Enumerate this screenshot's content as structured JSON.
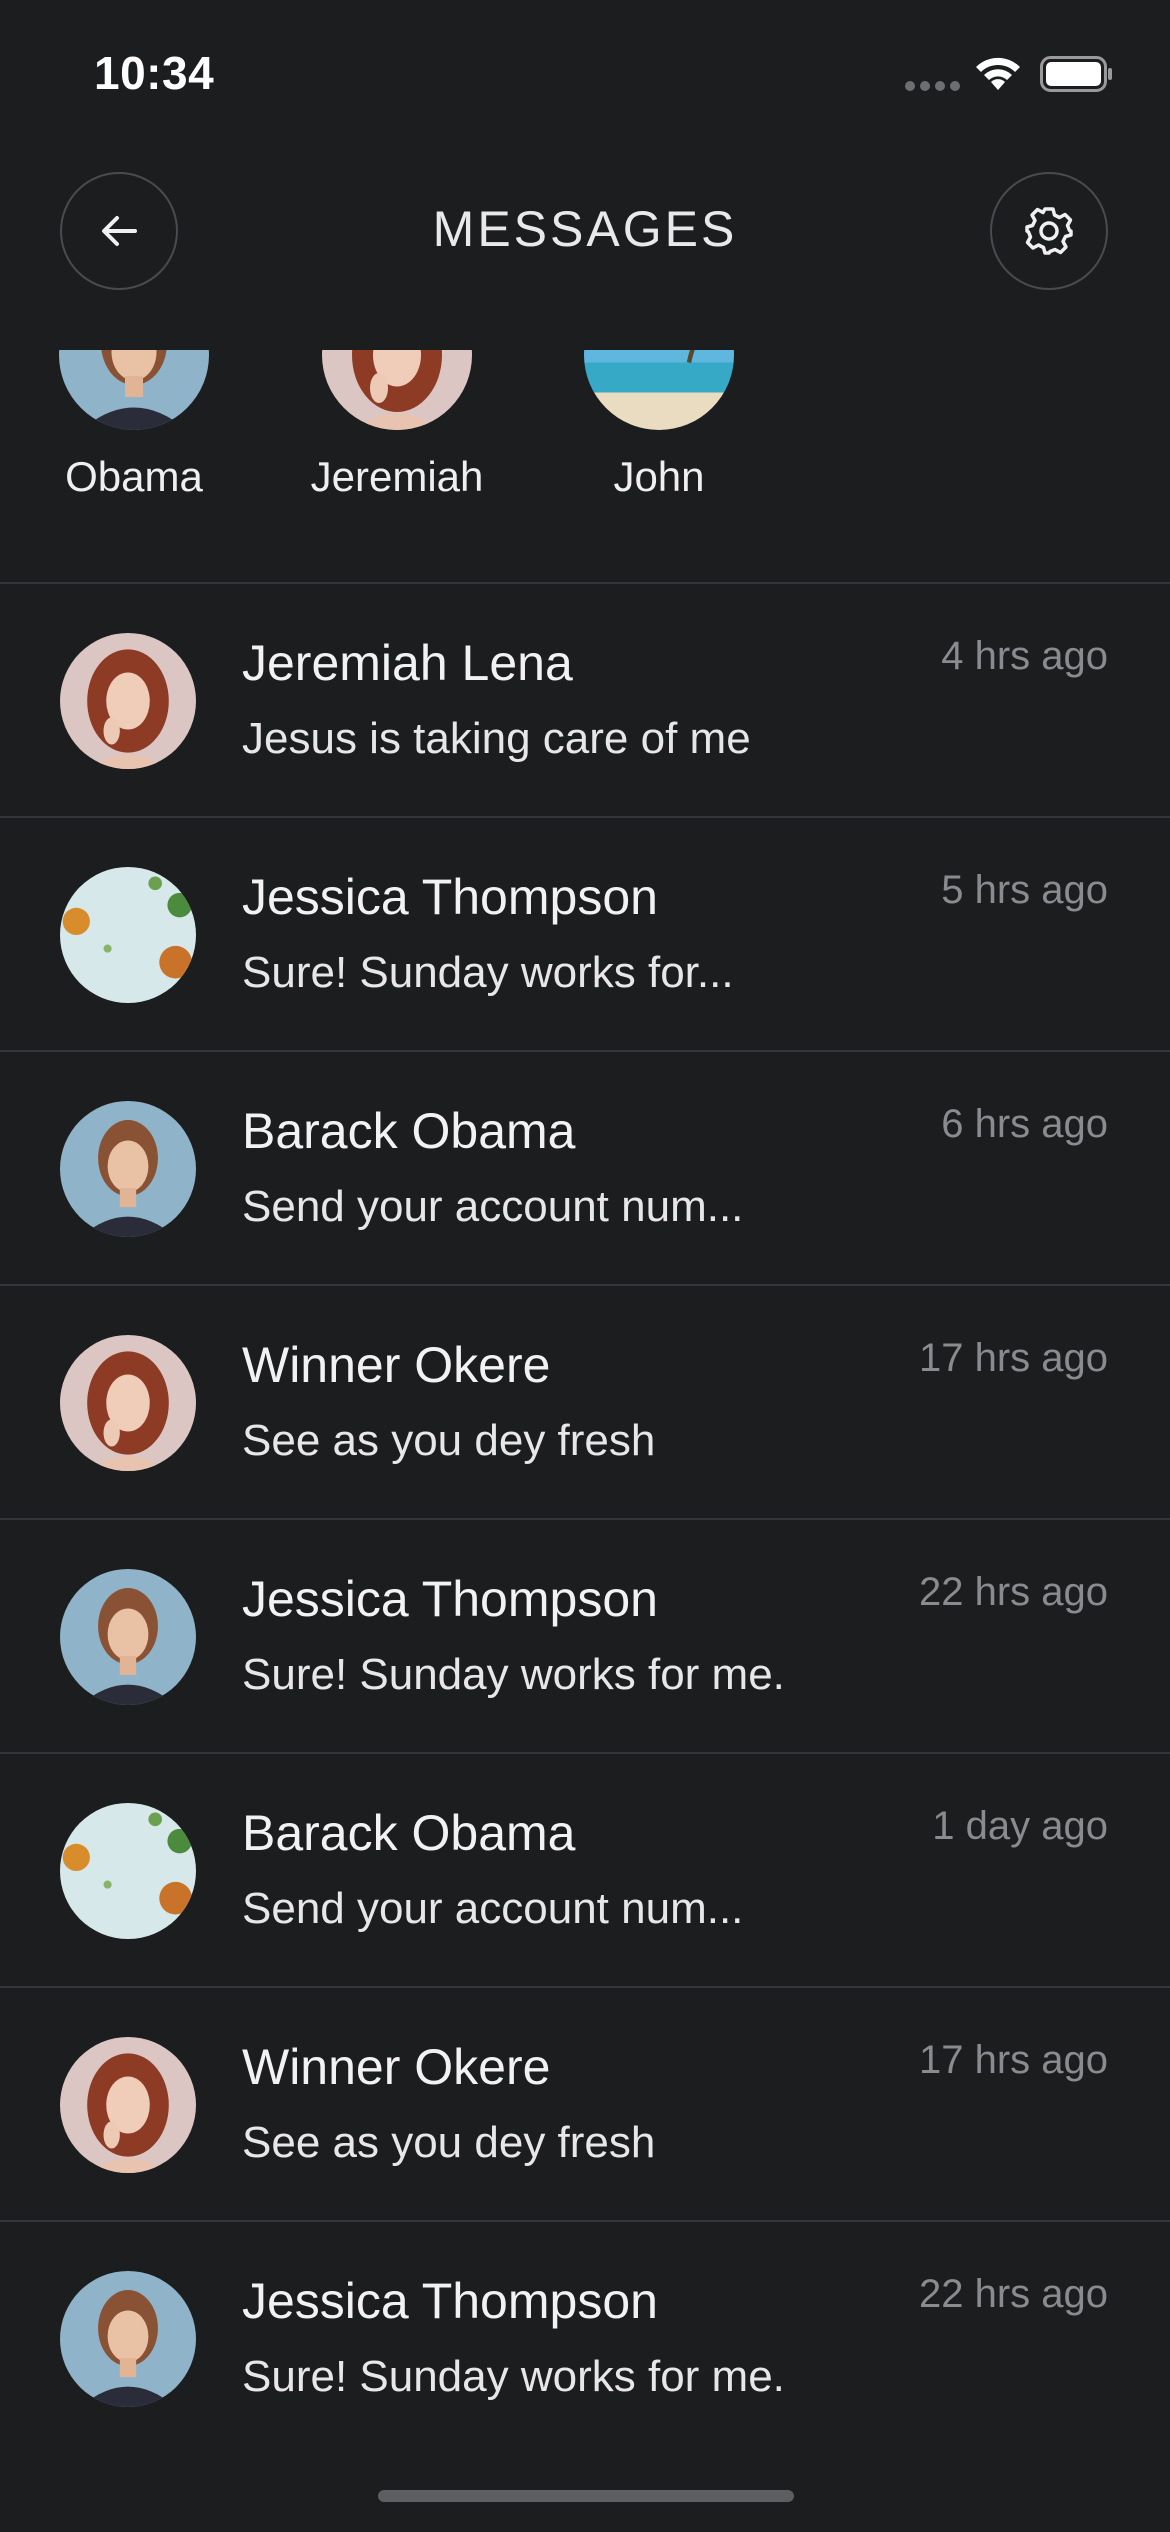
{
  "status_bar": {
    "time": "10:34"
  },
  "header": {
    "title": "MESSAGES",
    "back_icon": "arrow-left-icon",
    "settings_icon": "gear-icon"
  },
  "stories": [
    {
      "name": "Obama",
      "avatar": "woman-bob-portrait"
    },
    {
      "name": "Jeremiah",
      "avatar": "woman-red-hair-portrait"
    },
    {
      "name": "John",
      "avatar": "beach-palm-photo"
    }
  ],
  "messages": [
    {
      "name": "Jeremiah Lena",
      "preview": "Jesus is taking care of me",
      "time": "4 hrs ago",
      "avatar": "woman-red-hair-portrait"
    },
    {
      "name": "Jessica Thompson",
      "preview": "Sure! Sunday works for...",
      "time": "5 hrs ago",
      "avatar": "food-flatlay-photo"
    },
    {
      "name": "Barack Obama",
      "preview": "Send your account num...",
      "time": "6 hrs ago",
      "avatar": "woman-bob-portrait"
    },
    {
      "name": "Winner Okere",
      "preview": "See as you dey fresh",
      "time": "17 hrs ago",
      "avatar": "woman-red-hair-portrait"
    },
    {
      "name": "Jessica Thompson",
      "preview": "Sure! Sunday works for me.",
      "time": "22 hrs ago",
      "avatar": "woman-bob-portrait"
    },
    {
      "name": "Barack Obama",
      "preview": "Send your account num...",
      "time": "1 day ago",
      "avatar": "food-flatlay-photo"
    },
    {
      "name": "Winner Okere",
      "preview": "See as you dey fresh",
      "time": "17 hrs ago",
      "avatar": "woman-red-hair-portrait"
    },
    {
      "name": "Jessica Thompson",
      "preview": "Sure! Sunday works for me.",
      "time": "22 hrs ago",
      "avatar": "woman-bob-portrait"
    }
  ],
  "colors": {
    "background": "#1c1d1f",
    "divider": "#34353a",
    "time_text": "#8a8b8f",
    "text": "#f2f2f2"
  }
}
